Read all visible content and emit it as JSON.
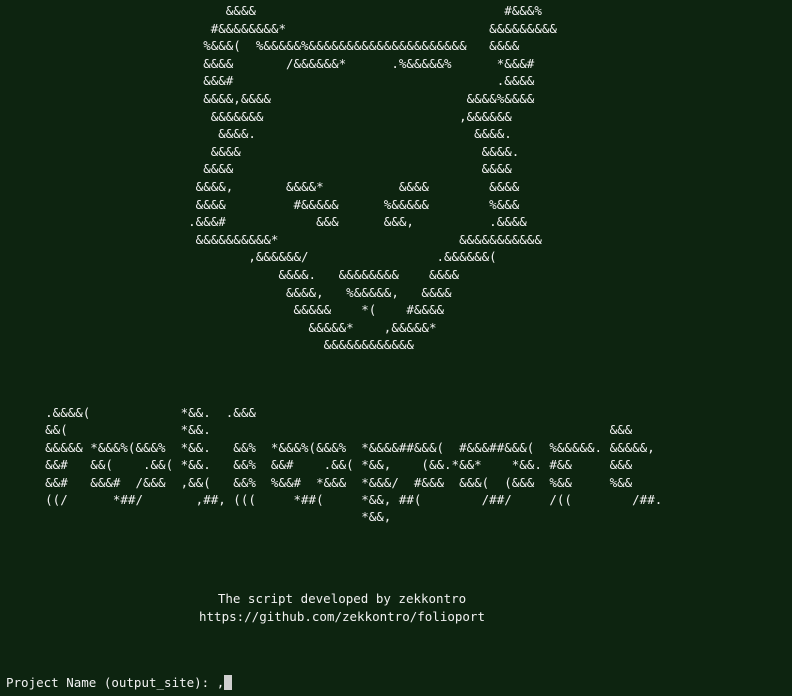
{
  "mask_art": [
    "                              &&&&                                 #&&&%",
    "                            #&&&&&&&&*                           &&&&&&&&&",
    "                           %&&&(  %&&&&&%&&&&&&&&&&&&&&&&&&&&&   &&&&",
    "                           &&&&       /&&&&&&*      .%&&&&&%      *&&&#",
    "                           &&&#                                   .&&&&",
    "                           &&&&,&&&&                          &&&&%&&&&",
    "                            &&&&&&&                          ,&&&&&&",
    "                             &&&&.                             &&&&.",
    "                            &&&&                                &&&&.",
    "                           &&&&                                 &&&&",
    "                          &&&&,       &&&&*          &&&&        &&&&",
    "                          &&&&         #&&&&&      %&&&&&        %&&&",
    "                         .&&&#            &&&      &&&,          .&&&&",
    "                          &&&&&&&&&&*                        &&&&&&&&&&&",
    "                                 ,&&&&&&/                 .&&&&&&(",
    "                                     &&&&.   &&&&&&&&    &&&&",
    "                                      &&&&,   %&&&&&,   &&&&",
    "                                       &&&&&    *(    #&&&&",
    "                                         &&&&&*    ,&&&&&*",
    "                                           &&&&&&&&&&&&"
  ],
  "logo_art": [
    "      .&&&&(            *&&.  .&&&",
    "      &&(               *&&.                                                     &&&",
    "      &&&&& *&&&%(&&&%  *&&.   &&%  *&&&%(&&&%  *&&&&##&&&(  #&&&##&&&(  %&&&&&. &&&&&,",
    "      &&#   &&(    .&&( *&&.   &&%  &&#    .&&( *&&,    (&&.*&&*    *&&. #&&     &&&",
    "      &&#   &&&#  /&&&  ,&&(   &&%  %&&#  *&&&  *&&&/  #&&&  &&&(  (&&&  %&&     %&&",
    "      ((/      *##/       ,##, (((     *##(     *&&, ##(        /##/     /((        /##.",
    "                                                *&&,"
  ],
  "credits": {
    "line1": "The script developed by zekkontro",
    "line2": "https://github.com/zekkontro/folioport"
  },
  "prompt": {
    "label": "Project Name (output_site): ",
    "value": ","
  }
}
